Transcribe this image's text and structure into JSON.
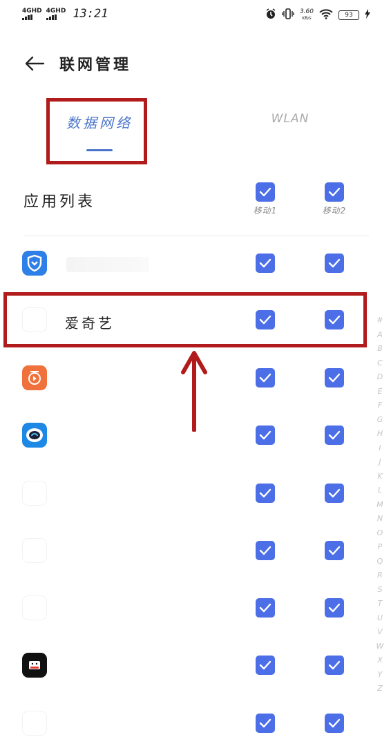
{
  "status_bar": {
    "signal1": "4GHD",
    "signal2": "4GHD",
    "time": "13:21",
    "speed_value": "3.60",
    "speed_unit": "KB/s",
    "battery": "93"
  },
  "header": {
    "title": "联网管理"
  },
  "tabs": [
    {
      "label": "数据网络",
      "active": true
    },
    {
      "label": "WLAN",
      "active": false
    }
  ],
  "list": {
    "title": "应用列表",
    "columns": [
      "移动1",
      "移动2"
    ],
    "rows": [
      {
        "name": "",
        "icon": "shield-app-icon",
        "sim1": true,
        "sim2": true
      },
      {
        "name": "爱奇艺",
        "icon": "iqiyi-app-icon",
        "sim1": true,
        "sim2": true
      },
      {
        "name": "",
        "icon": "orange-play-app-icon",
        "sim1": true,
        "sim2": true
      },
      {
        "name": "",
        "icon": "robot-app-icon",
        "sim1": true,
        "sim2": true
      },
      {
        "name": "",
        "icon": "blank-app-icon",
        "sim1": true,
        "sim2": true
      },
      {
        "name": "",
        "icon": "blank-app-icon",
        "sim1": true,
        "sim2": true
      },
      {
        "name": "",
        "icon": "blank-app-icon",
        "sim1": true,
        "sim2": true
      },
      {
        "name": "",
        "icon": "apk-app-icon",
        "sim1": true,
        "sim2": true
      },
      {
        "name": "",
        "icon": "blank-app-icon",
        "sim1": true,
        "sim2": true
      }
    ]
  },
  "alpha_index": [
    "#",
    "A",
    "B",
    "C",
    "D",
    "E",
    "F",
    "G",
    "H",
    "I",
    "J",
    "K",
    "L",
    "M",
    "N",
    "O",
    "P",
    "Q",
    "R",
    "S",
    "T",
    "U",
    "V",
    "W",
    "X",
    "Y",
    "Z"
  ],
  "colors": {
    "accent": "#4c6ee6",
    "tab_active": "#4a74c9",
    "annotation": "#b11b1b"
  }
}
